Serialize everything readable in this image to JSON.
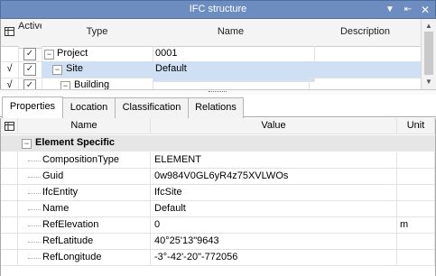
{
  "window": {
    "title": "IFC structure"
  },
  "tree": {
    "columns": {
      "active": "Active",
      "type": "Type",
      "name": "Name",
      "description": "Description"
    },
    "rows": [
      {
        "type": "Project",
        "name": "0001",
        "description": "",
        "active": true,
        "expander": "⊟",
        "marker": ""
      },
      {
        "type": "Site",
        "name": "Default",
        "description": "",
        "active": true,
        "expander": "⊟",
        "marker": "√",
        "selected": true
      },
      {
        "type": "Building",
        "name": "",
        "description": "",
        "active": true,
        "expander": "⊟",
        "marker": "√"
      }
    ]
  },
  "tabs": [
    "Properties",
    "Location",
    "Classification",
    "Relations"
  ],
  "active_tab": "Properties",
  "properties": {
    "columns": {
      "name": "Name",
      "value": "Value",
      "unit": "Unit"
    },
    "category": "Element Specific",
    "rows": [
      {
        "name": "CompositionType",
        "value": "ELEMENT",
        "unit": ""
      },
      {
        "name": "Guid",
        "value": "0w984V0GL6yR4z75XVLWOs",
        "unit": ""
      },
      {
        "name": "IfcEntity",
        "value": "IfcSite",
        "unit": ""
      },
      {
        "name": "Name",
        "value": "Default",
        "unit": ""
      },
      {
        "name": "RefElevation",
        "value": "0",
        "unit": "m"
      },
      {
        "name": "RefLatitude",
        "value": "40°25'13\"9643",
        "unit": ""
      },
      {
        "name": "RefLongitude",
        "value": "-3°-42'-20\"-772056",
        "unit": ""
      }
    ]
  }
}
